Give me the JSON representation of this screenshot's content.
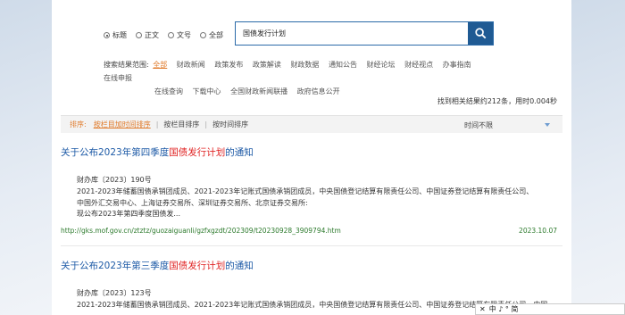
{
  "search": {
    "radios": [
      {
        "label": "标题",
        "checked": true
      },
      {
        "label": "正文",
        "checked": false
      },
      {
        "label": "文号",
        "checked": false
      },
      {
        "label": "全部",
        "checked": false
      }
    ],
    "query": "国债发行计划",
    "button_icon": "search-icon"
  },
  "scope": {
    "label": "搜索结果范围:",
    "items": [
      "全部",
      "财政新闻",
      "政策发布",
      "政策解读",
      "财政数据",
      "通知公告",
      "财经论坛",
      "财经视点",
      "办事指南",
      "在线申报"
    ],
    "items2": [
      "在线查询",
      "下载中心",
      "全国财政新闻联播",
      "政府信息公开"
    ]
  },
  "stats": "找到相关结果约212条，用时0.004秒",
  "sort": {
    "label": "排序:",
    "options": [
      "按栏目加时间排序",
      "按栏目排序",
      "按时间排序"
    ],
    "time_filter": "时间不限"
  },
  "results": [
    {
      "title_pre": "关于公布2023年第四季度",
      "title_hl": "国债发行计划",
      "title_post": "的通知",
      "doc_no": "财办库〔2023〕190号",
      "body1": "2021-2023年储蓄国债承销团成员、2021-2023年记账式国债承销团成员，中央国债登记结算有限责任公司、中国证券登记结算有限责任公司、",
      "body2": "中国外汇交易中心、上海证券交易所、深圳证券交易所、北京证券交易所:",
      "body3": "现公布2023年第四季度国债发...",
      "url": "http://gks.mof.gov.cn/ztztz/guozaiguanli/gzfxgzdt/202309/t20230928_3909794.htm",
      "date": "2023.10.07"
    },
    {
      "title_pre": "关于公布2023年第三季度",
      "title_hl": "国债发行计划",
      "title_post": "的通知",
      "doc_no": "财办库〔2023〕123号",
      "body1": "2021-2023年储蓄国债承销团成员、2021-2023年记账式国债承销团成员，中央国债登记结算有限责任公司、中国证券登记结算有限责任公司、中国"
    }
  ],
  "float_tool": {
    "close": "✕",
    "text": "中 ♪ ° 简"
  }
}
